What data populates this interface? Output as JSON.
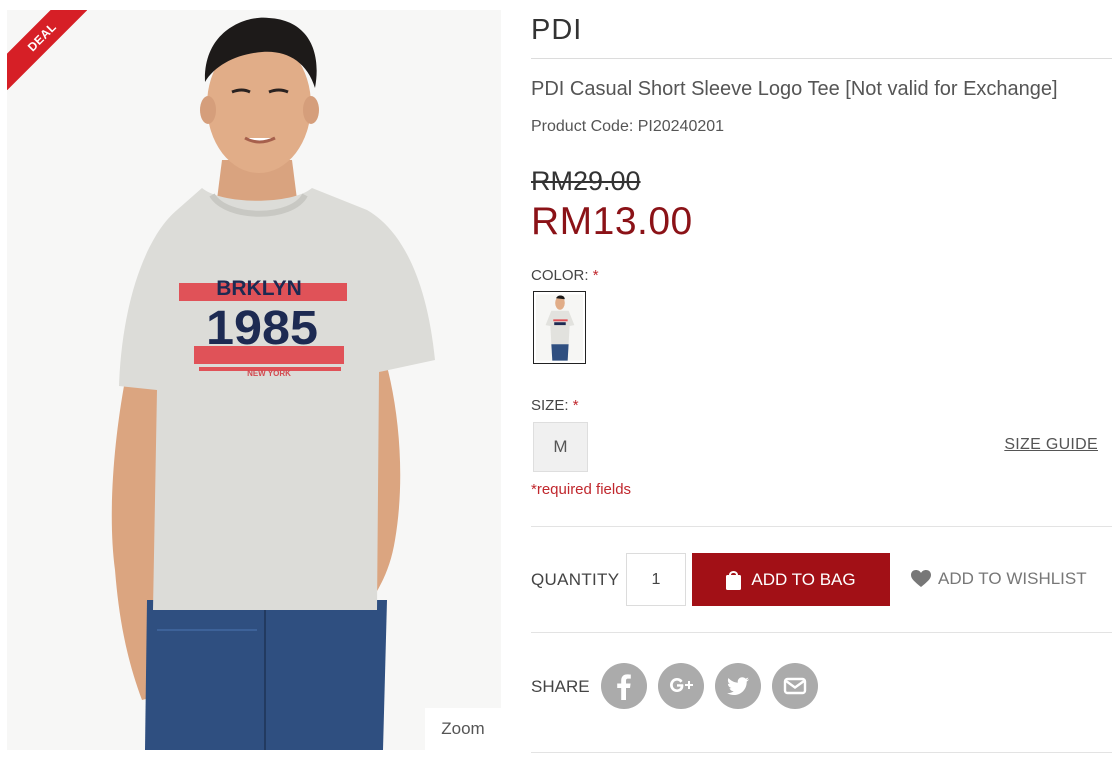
{
  "gallery": {
    "badge": "DEAL",
    "zoom_label": "Zoom",
    "shirt_print": {
      "top": "BRKLYN",
      "year": "1985",
      "bottom": "NEW YORK"
    }
  },
  "product": {
    "brand": "PDI",
    "name": "PDI Casual Short Sleeve Logo Tee [Not valid for Exchange]",
    "code": "Product Code: PI20240201",
    "old_price": "RM29.00",
    "price": "RM13.00"
  },
  "options": {
    "color_label": "COLOR:",
    "size_label": "SIZE:",
    "required_mark": "*",
    "size_value": "M",
    "size_guide": "SIZE GUIDE",
    "required_note": "*required fields"
  },
  "purchase": {
    "quantity_label": "QUANTITY",
    "quantity_value": "1",
    "add_to_bag": "ADD TO BAG",
    "add_to_wishlist": "ADD TO WISHLIST"
  },
  "share": {
    "label": "SHARE",
    "icons": [
      "facebook-icon",
      "google-plus-icon",
      "twitter-icon",
      "email-icon"
    ]
  },
  "colors": {
    "price_red": "#8b1217",
    "button_red": "#a21016",
    "badge_red": "#d61f26",
    "share_grey": "#ababab"
  }
}
